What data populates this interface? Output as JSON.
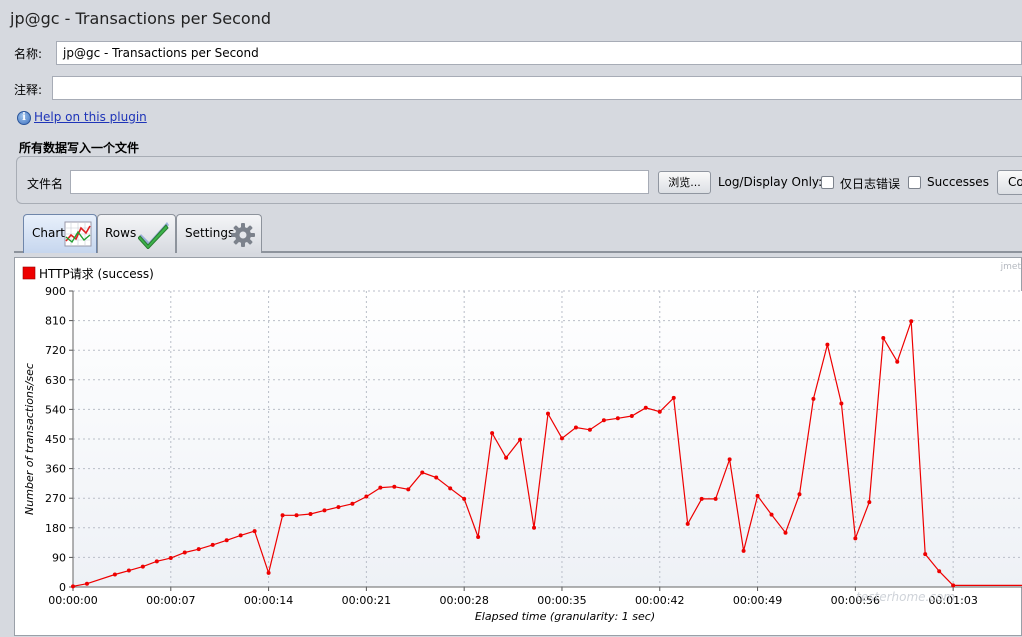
{
  "window": {
    "title": "jp@gc - Transactions per Second"
  },
  "form": {
    "name_label": "名称:",
    "name_value": "jp@gc - Transactions per Second",
    "comment_label": "注释:",
    "comment_value": "",
    "help_link": "Help on this plugin"
  },
  "file_section": {
    "title": "所有数据写入一个文件",
    "filename_label": "文件名",
    "filename_value": "",
    "browse_button": "浏览...",
    "log_display_label": "Log/Display Only:",
    "errors_only_label": "仅日志错误",
    "successes_label": "Successes",
    "config_button_partial": "Co"
  },
  "tabs": [
    {
      "label": "Chart",
      "icon": "chart-line-icon",
      "active": true
    },
    {
      "label": "Rows",
      "icon": "checkmark-icon",
      "active": false
    },
    {
      "label": "Settings",
      "icon": "gear-icon",
      "active": false
    }
  ],
  "chart_watermark": "jmet",
  "site_watermark": "testerhome.com",
  "colors": {
    "series": "#ee0000",
    "grid": "#b9bec8",
    "plot_bg_top": "#ffffff",
    "plot_bg_bottom": "#eef1f6"
  },
  "chart_data": {
    "type": "line",
    "xlabel": "Elapsed time (granularity: 1 sec)",
    "ylabel": "Number of transactions/sec",
    "ylim": [
      0,
      900
    ],
    "xlim": [
      0,
      68
    ],
    "yticks": [
      0,
      90,
      180,
      270,
      360,
      450,
      540,
      630,
      720,
      810,
      900
    ],
    "xticks": [
      0,
      7,
      14,
      21,
      28,
      35,
      42,
      49,
      56,
      63
    ],
    "xtick_labels": [
      "00:00:00",
      "00:00:07",
      "00:00:14",
      "00:00:21",
      "00:00:28",
      "00:00:35",
      "00:00:42",
      "00:00:49",
      "00:00:56",
      "00:01:03"
    ],
    "legend": "top-left",
    "grid": true,
    "series": [
      {
        "name": "HTTP请求 (success)",
        "x": [
          0,
          1,
          3,
          4,
          5,
          6,
          7,
          8,
          9,
          10,
          11,
          12,
          13,
          14,
          15,
          16,
          17,
          18,
          19,
          20,
          21,
          22,
          23,
          24,
          25,
          26,
          27,
          28,
          29,
          30,
          31,
          32,
          33,
          34,
          35,
          36,
          37,
          38,
          39,
          40,
          41,
          42,
          43,
          44,
          45,
          46,
          47,
          48,
          49,
          50,
          51,
          52,
          53,
          54,
          55,
          56,
          57,
          58,
          59,
          60,
          61,
          62,
          63,
          68
        ],
        "y": [
          2,
          10,
          38,
          50,
          62,
          78,
          88,
          105,
          115,
          128,
          142,
          157,
          170,
          43,
          218,
          218,
          222,
          233,
          243,
          253,
          275,
          302,
          305,
          297,
          348,
          333,
          300,
          268,
          152,
          468,
          393,
          448,
          180,
          527,
          452,
          485,
          478,
          507,
          513,
          520,
          545,
          533,
          575,
          192,
          268,
          268,
          388,
          110,
          277,
          220,
          165,
          282,
          572,
          737,
          558,
          148,
          258,
          757,
          685,
          808,
          100,
          48,
          5,
          5
        ]
      }
    ]
  }
}
